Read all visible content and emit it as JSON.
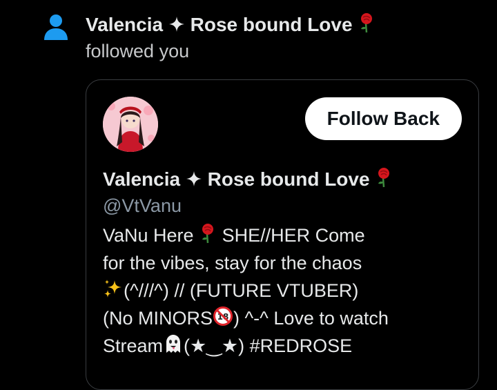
{
  "notification": {
    "icon": "person-icon",
    "actor_name": "Valencia",
    "actor_name_rest": "Rose bound Love",
    "action": "followed you"
  },
  "profile_card": {
    "name": "Valencia",
    "name_rest": "Rose bound Love",
    "handle": "@VtVanu",
    "follow_back_label": "Follow Back",
    "bio": {
      "line1a": "VaNu Here",
      "line1b": "SHE//HER Come",
      "line2": "for the vibes, stay for the chaos",
      "line3": "(^///^) // (FUTURE VTUBER)",
      "line4a": "(No MINORS",
      "line4b": ") ^-^ Love to watch",
      "line5a": "Stream",
      "line5b": "(★‿★) #REDROSE"
    }
  },
  "colors": {
    "background": "#000000",
    "accent_blue": "#1d9bf0",
    "text_primary": "#e7e9ea",
    "text_secondary": "#8b98a5",
    "card_border": "#3a3d41",
    "rose_red": "#d4161d"
  }
}
